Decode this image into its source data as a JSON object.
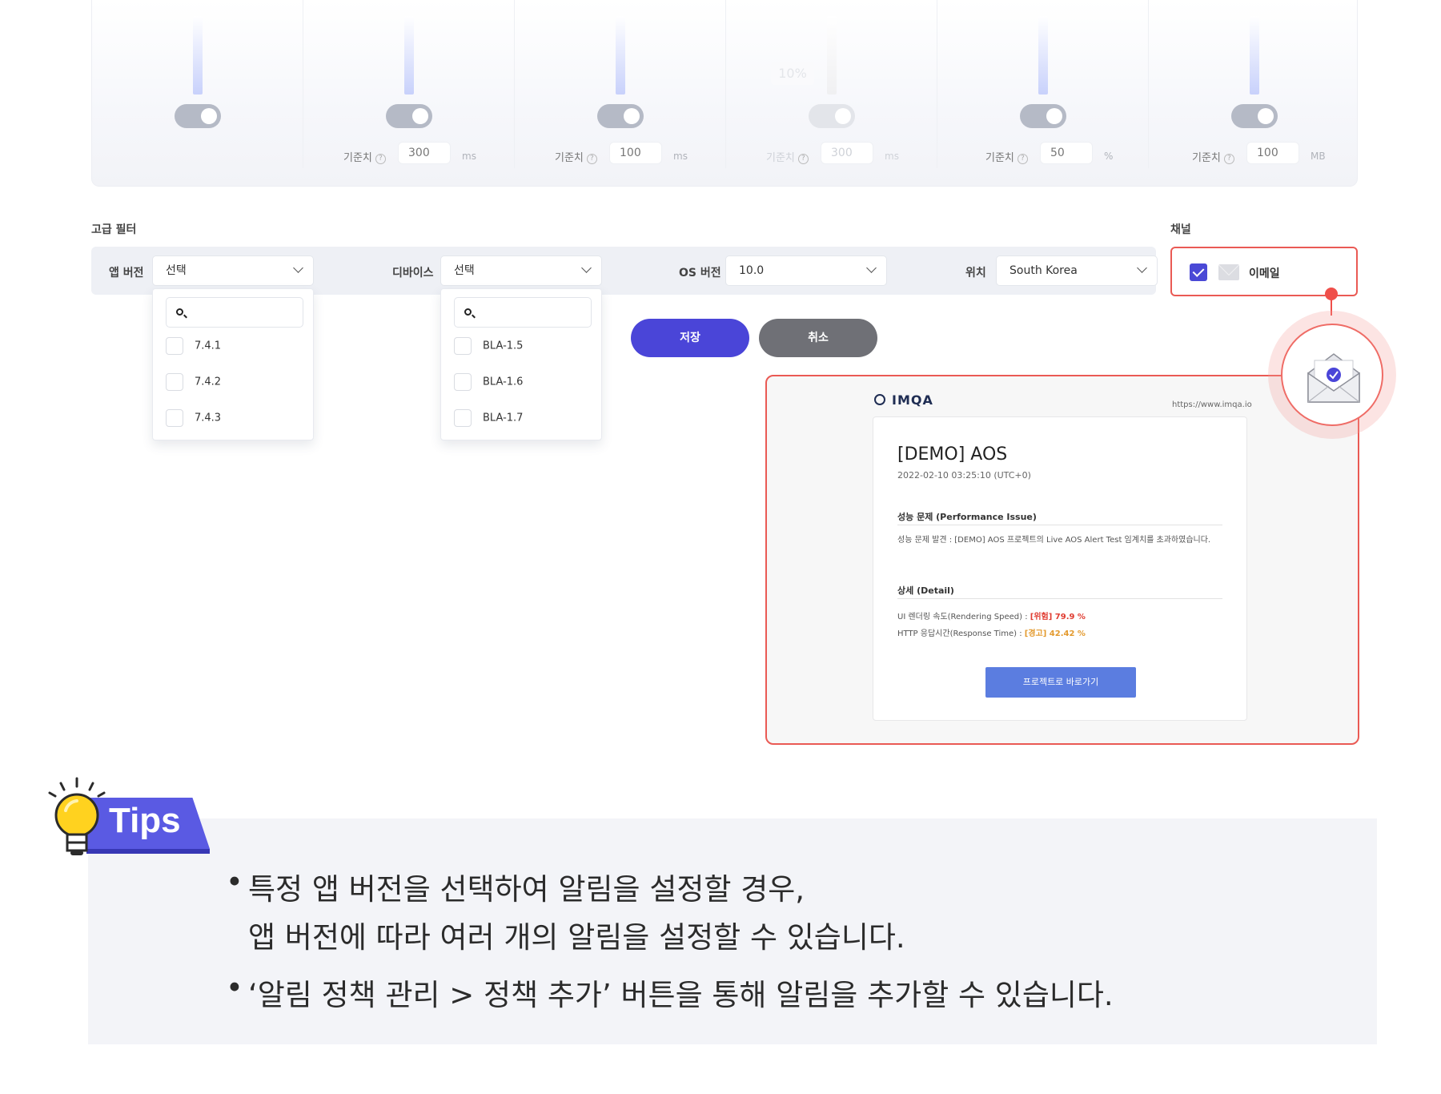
{
  "thresholds": [
    {
      "label": "",
      "value": "",
      "unit": "",
      "enabled": true
    },
    {
      "label": "기준치",
      "value": "300",
      "unit": "ms",
      "enabled": true
    },
    {
      "label": "기준치",
      "value": "100",
      "unit": "ms",
      "enabled": true
    },
    {
      "label": "기준치",
      "value": "300",
      "unit": "ms",
      "enabled": false
    },
    {
      "label": "기준치",
      "value": "50",
      "unit": "%",
      "enabled": true
    },
    {
      "label": "기준치",
      "value": "100",
      "unit": "MB",
      "enabled": true
    }
  ],
  "percent_badge": "10%",
  "help_glyph": "?",
  "advanced_filter": {
    "title": "고급 필터",
    "app_version": {
      "label": "앱 버전",
      "value": "선택",
      "options": [
        "7.4.1",
        "7.4.2",
        "7.4.3"
      ]
    },
    "device": {
      "label": "디바이스",
      "value": "선택",
      "options": [
        "BLA-1.5",
        "BLA-1.6",
        "BLA-1.7"
      ]
    },
    "os_version": {
      "label": "OS 버전",
      "value": "10.0"
    },
    "location": {
      "label": "위치",
      "value": "South Korea"
    }
  },
  "channel": {
    "title": "채널",
    "option_label": "이메일",
    "checked": true,
    "accent": "#4a49d6"
  },
  "buttons": {
    "save": "저장",
    "cancel": "취소"
  },
  "email_preview": {
    "brand": "IMQA",
    "url": "https://www.imqa.io",
    "title": "[DEMO] AOS",
    "date": "2022-02-10 03:25:10 (UTC+0)",
    "section1_heading": "성능 문제 (Performance Issue)",
    "section1_text": "성능 문제 발견 : [DEMO] AOS 프로젝트의 Live AOS Alert Test 임계치를 초과하였습니다.",
    "section2_heading": "상세 (Detail)",
    "detail1_label": "UI 렌더링 속도(Rendering Speed) : ",
    "detail1_value": "[위험] 79.9 %",
    "detail2_label": "HTTP 응답시간(Response Time) : ",
    "detail2_value": "[경고] 42.42 %",
    "button": "프로젝트로 바로가기"
  },
  "tips": {
    "badge": "Tips",
    "bullet": "•",
    "item1_line1": "특정 앱 버전을 선택하여 알림을 설정할 경우,",
    "item1_line2": "앱 버전에 따라 여러 개의 알림을 설정할 수 있습니다.",
    "item2": "‘알림 정책 관리 > 정책 추가’ 버튼을 통해 알림을 추가할 수 있습니다."
  },
  "colors": {
    "primary": "#4a45d8",
    "cancel": "#6f7076",
    "highlight": "#ea5a54",
    "danger": "#e03c31",
    "warning": "#e39a2e"
  }
}
